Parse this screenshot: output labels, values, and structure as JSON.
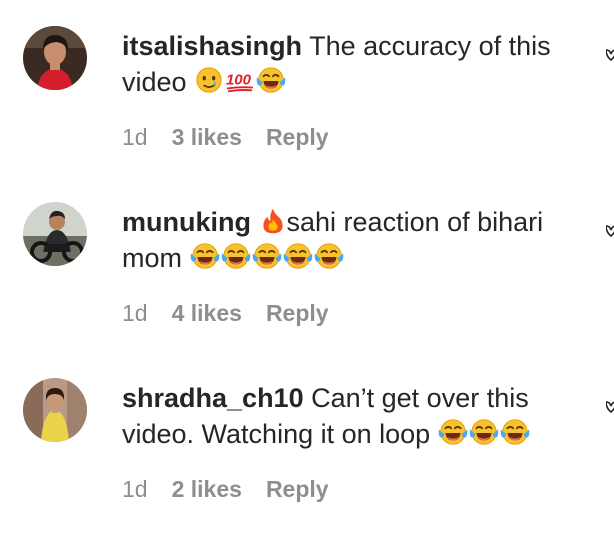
{
  "comments": [
    {
      "username": "itsalishasingh",
      "text": "The accuracy of this video",
      "emojis": [
        "smiling-face-with-tear",
        "hundred-points",
        "face-with-tears-of-joy"
      ],
      "time": "1d",
      "likes": "3 likes",
      "reply": "Reply"
    },
    {
      "username": "munuking",
      "text": "sahi reaction of bihari mom",
      "lead_emoji": "fire",
      "emojis": [
        "face-with-tears-of-joy",
        "face-with-tears-of-joy",
        "face-with-tears-of-joy",
        "face-with-tears-of-joy",
        "face-with-tears-of-joy"
      ],
      "time": "1d",
      "likes": "4 likes",
      "reply": "Reply"
    },
    {
      "username": "shradha_ch10",
      "text": "Can’t get over this video. Watching it on loop",
      "emojis": [
        "face-with-tears-of-joy",
        "face-with-tears-of-joy",
        "face-with-tears-of-joy"
      ],
      "time": "1d",
      "likes": "2 likes",
      "reply": "Reply"
    }
  ],
  "colors": {
    "text": "#262626",
    "secondary": "#8e8e8e"
  }
}
